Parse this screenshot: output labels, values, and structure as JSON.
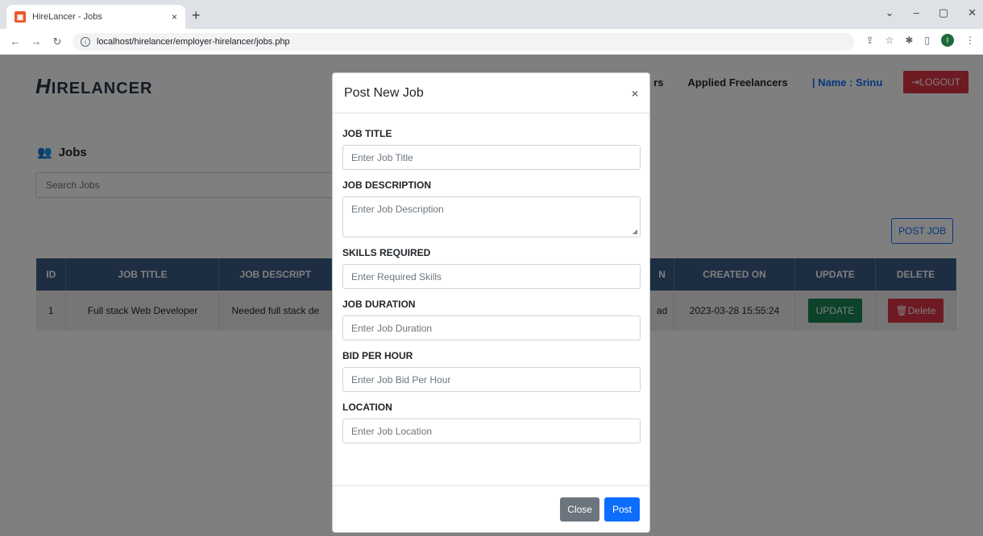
{
  "browser": {
    "tab_title": "HireLancer - Jobs",
    "tab_close": "×",
    "new_tab": "+",
    "url": "localhost/hirelancer/employer-hirelancer/jobs.php",
    "profile_initial": "I"
  },
  "header": {
    "logo": "IRELANCER",
    "logo_letter": "H",
    "nav": {
      "freelancers_fragment": "rs",
      "applied": "Applied Freelancers",
      "name": "| Name : Srinu",
      "logout": "LOGOUT"
    }
  },
  "jobs": {
    "heading": "Jobs",
    "search_placeholder": "Search Jobs",
    "post_job": "POST JOB",
    "columns": {
      "id": "ID",
      "title": "JOB TITLE",
      "desc": "JOB DESCRIPT",
      "loc": "N",
      "created": "CREATED ON",
      "update": "UPDATE",
      "delete": "DELETE"
    },
    "row": {
      "id": "1",
      "title": "Full stack Web Developer",
      "desc": "Needed full stack de",
      "loc": "ad",
      "created": "2023-03-28 15:55:24",
      "update": "UPDATE",
      "delete": "Delete"
    }
  },
  "modal": {
    "title": "Post New Job",
    "close_x": "×",
    "fields": {
      "title": {
        "label": "JOB TITLE",
        "placeholder": "Enter Job Title"
      },
      "description": {
        "label": "JOB DESCRIPTION",
        "placeholder": "Enter Job Description"
      },
      "skills": {
        "label": "SKILLS REQUIRED",
        "placeholder": "Enter Required Skills"
      },
      "duration": {
        "label": "JOB DURATION",
        "placeholder": "Enter Job Duration"
      },
      "bid": {
        "label": "BID PER HOUR",
        "placeholder": "Enter Job Bid Per Hour"
      },
      "location": {
        "label": "LOCATION",
        "placeholder": "Enter Job Location"
      }
    },
    "close_button": "Close",
    "post_button": "Post"
  },
  "colors": {
    "table_header": "#3b5c86",
    "primary": "#0d6efd",
    "danger": "#dc3545",
    "success": "#198754"
  }
}
